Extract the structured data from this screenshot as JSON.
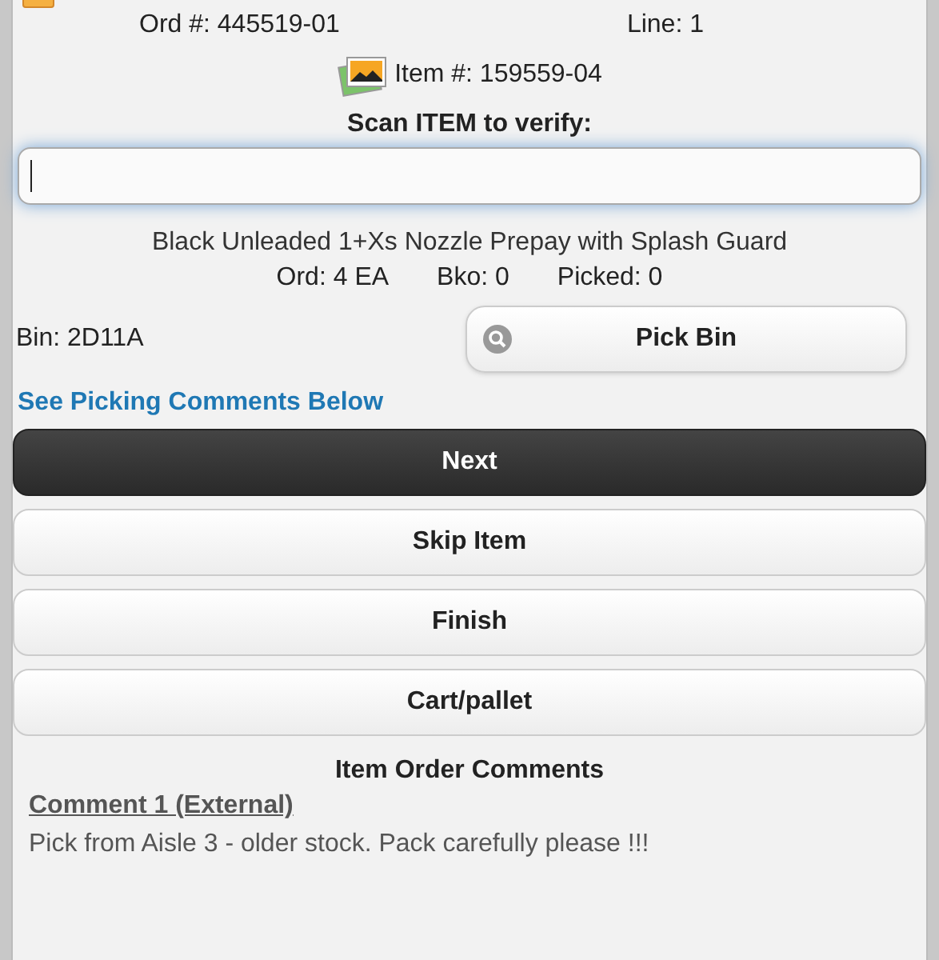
{
  "header": {
    "order": "Ord #: 445519-01",
    "line": "Line: 1"
  },
  "item": {
    "number": "Item #: 159559-04"
  },
  "scan": {
    "label": "Scan ITEM to verify:",
    "focused": true
  },
  "description": "Black Unleaded 1+Xs Nozzle Prepay with Splash Guard",
  "quantities": [
    "Ord: 4 EA",
    "Bko: 0",
    "Picked: 0"
  ],
  "bin": {
    "label": "Bin: 2D11A",
    "button": "Pick Bin"
  },
  "comments_link": "See Picking Comments Below",
  "buttons": [
    {
      "label": "Next",
      "kind": "primary"
    },
    {
      "label": "Skip Item",
      "kind": "default"
    },
    {
      "label": "Finish",
      "kind": "default"
    },
    {
      "label": "Cart/pallet",
      "kind": "default"
    }
  ],
  "comments": {
    "title": "Item Order Comments",
    "items": [
      {
        "heading": "Comment 1 (External)",
        "text": "Pick from Aisle 3 - older stock. Pack carefully please !!!"
      }
    ]
  }
}
